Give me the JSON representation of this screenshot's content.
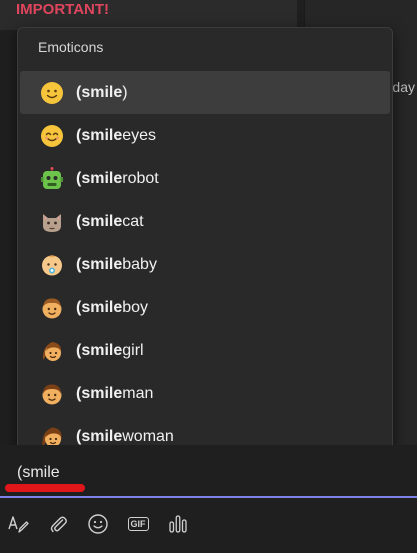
{
  "background": {
    "message_label": "IMPORTANT!",
    "side_text": "day"
  },
  "popup": {
    "header": "Emoticons",
    "items": [
      {
        "bold": "(smile",
        "rest": ")",
        "icon": "smile-emoji-icon",
        "selected": true
      },
      {
        "bold": "(smile",
        "rest": "eyes",
        "icon": "smileeyes-emoji-icon"
      },
      {
        "bold": "(smile",
        "rest": "robot",
        "icon": "smilerobot-emoji-icon"
      },
      {
        "bold": "(smile",
        "rest": "cat",
        "icon": "smilecat-emoji-icon"
      },
      {
        "bold": "(smile",
        "rest": "baby",
        "icon": "smilebaby-emoji-icon"
      },
      {
        "bold": "(smile",
        "rest": "boy",
        "icon": "smileboy-emoji-icon"
      },
      {
        "bold": "(smile",
        "rest": "girl",
        "icon": "smilegirl-emoji-icon"
      },
      {
        "bold": "(smile",
        "rest": "man",
        "icon": "smileman-emoji-icon"
      },
      {
        "bold": "(smile",
        "rest": "woman",
        "icon": "smilewoman-emoji-icon"
      }
    ]
  },
  "compose": {
    "input_value": "(smile",
    "toolbar": [
      {
        "name": "format-icon"
      },
      {
        "name": "attach-icon"
      },
      {
        "name": "emoji-icon"
      },
      {
        "name": "gif-icon",
        "label": "GIF"
      },
      {
        "name": "praise-icon"
      }
    ]
  },
  "colors": {
    "important": "#e0455e",
    "accent": "#7b83eb",
    "annotation_red": "#e0161b"
  }
}
